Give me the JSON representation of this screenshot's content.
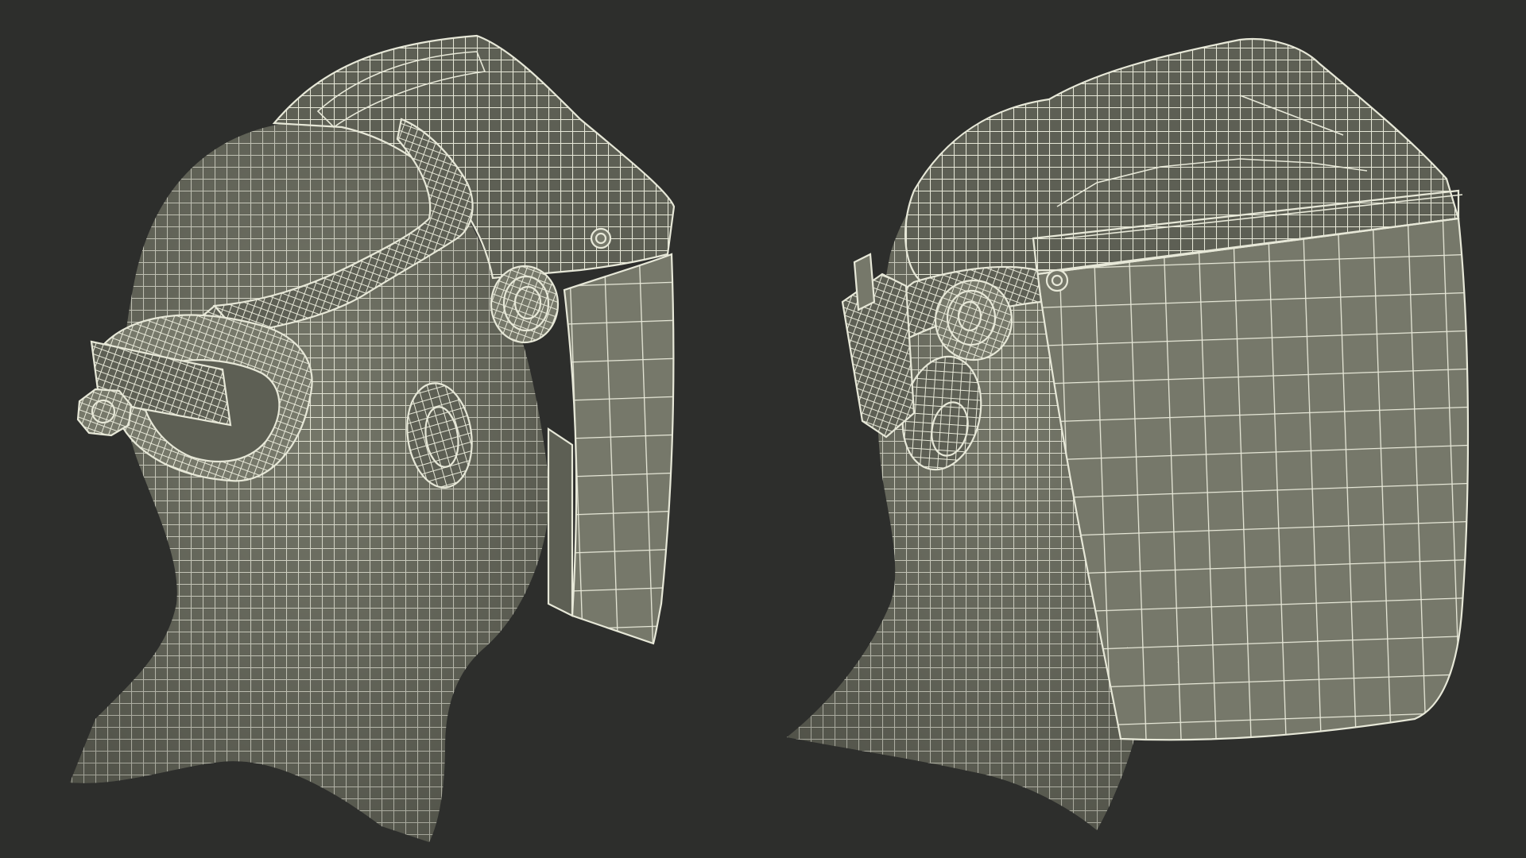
{
  "scene": {
    "background_color": "#2d2e2c",
    "mesh_fill_color": "#76786a",
    "mesh_shade_color": "#5d5f54",
    "wire_color": "#e7e8d8",
    "views": [
      {
        "name": "head-with-face-shield-raised"
      },
      {
        "name": "head-with-face-shield-lowered"
      }
    ]
  }
}
